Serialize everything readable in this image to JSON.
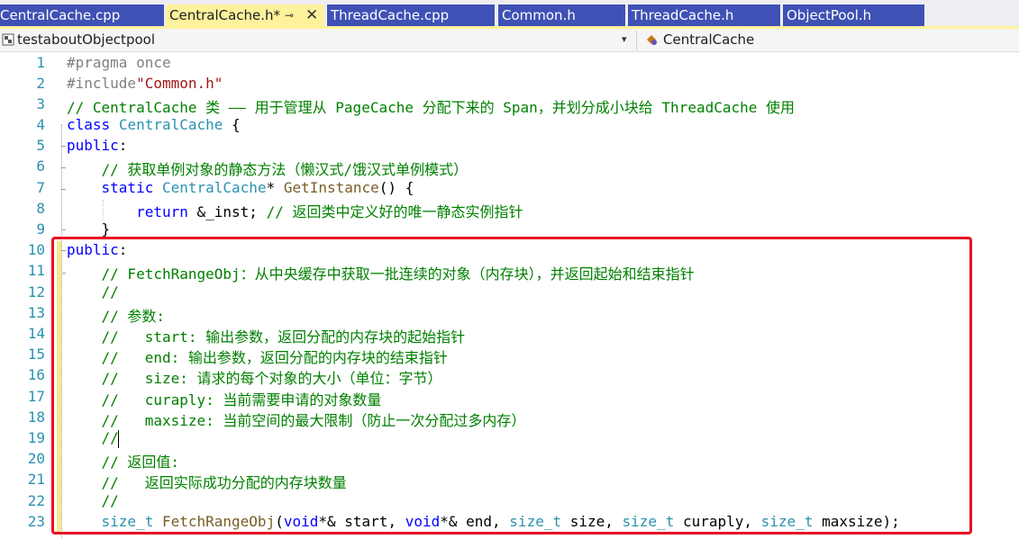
{
  "tabs": [
    {
      "label": "CentralCache.cpp",
      "active": false
    },
    {
      "label": "CentralCache.h*",
      "active": true
    },
    {
      "label": "ThreadCache.cpp",
      "active": false
    },
    {
      "label": "Common.h",
      "active": false
    },
    {
      "label": "ThreadCache.h",
      "active": false
    },
    {
      "label": "ObjectPool.h",
      "active": false
    }
  ],
  "tab_icons": {
    "pin": "⊸",
    "close": "✕"
  },
  "navbar": {
    "project": "testaboutObjectpool",
    "class": "CentralCache",
    "dropdown_icon": "▾"
  },
  "code": {
    "line_numbers": [
      "1",
      "2",
      "3",
      "4",
      "5",
      "6",
      "7",
      "8",
      "9",
      "10",
      "11",
      "12",
      "13",
      "14",
      "15",
      "16",
      "17",
      "18",
      "19",
      "20",
      "21",
      "22",
      "23"
    ]
  },
  "colors": {
    "tab_active": "#fff29d",
    "tab_inactive": "#3f51b5",
    "line_number": "#2b91af",
    "keyword": "#0000ff",
    "comment": "#008000",
    "string": "#a31515",
    "type": "#2b91af",
    "function": "#795e26",
    "highlight_box": "#e81123"
  },
  "code_lines": {
    "l1a": "#pragma",
    "l1b": " once",
    "l2a": "#include",
    "l2b": "\"Common.h\"",
    "l3": "// CentralCache 类 —— 用于管理从 PageCache 分配下来的 Span，并划分成小块给 ThreadCache 使用",
    "l4a": "class",
    "l4b": " ",
    "l4c": "CentralCache",
    "l4d": " {",
    "l5a": "public",
    "l5b": ":",
    "l6": "    // 获取单例对象的静态方法（懒汉式/饿汉式单例模式）",
    "l7a": "    ",
    "l7b": "static",
    "l7c": " ",
    "l7d": "CentralCache",
    "l7e": "* ",
    "l7f": "GetInstance",
    "l7g": "() {",
    "l8a": "        ",
    "l8b": "return",
    "l8c": " &_inst; ",
    "l8d": "// 返回类中定义好的唯一静态实例指针",
    "l9": "    }",
    "l10a": "public",
    "l10b": ":",
    "l11": "    // FetchRangeObj：从中央缓存中获取一批连续的对象（内存块），并返回起始和结束指针",
    "l12": "    //",
    "l13": "    // 参数:",
    "l14": "    //   start: 输出参数，返回分配的内存块的起始指针",
    "l15": "    //   end: 输出参数，返回分配的内存块的结束指针",
    "l16": "    //   size: 请求的每个对象的大小（单位：字节）",
    "l17": "    //   curaply: 当前需要申请的对象数量",
    "l18": "    //   maxsize: 当前空间的最大限制（防止一次分配过多内存）",
    "l19": "    //",
    "l20": "    // 返回值:",
    "l21": "    //   返回实际成功分配的内存块数量",
    "l22": "    //",
    "l23a": "    ",
    "l23b": "size_t",
    "l23c": " ",
    "l23d": "FetchRangeObj",
    "l23e": "(",
    "l23f": "void",
    "l23g": "*& start, ",
    "l23h": "void",
    "l23i": "*& end, ",
    "l23j": "size_t",
    "l23k": " size, ",
    "l23l": "size_t",
    "l23m": " curaply, ",
    "l23n": "size_t",
    "l23o": " maxsize);"
  }
}
